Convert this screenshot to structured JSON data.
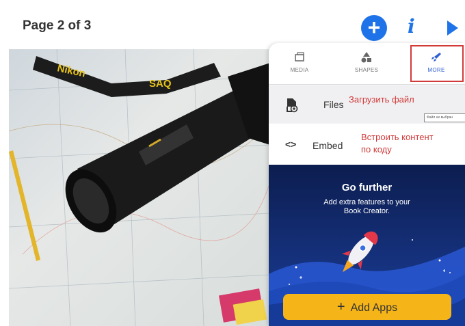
{
  "header": {
    "page_indicator": "Page 2 of 3",
    "add_icon": "plus-icon",
    "info_icon": "info-icon",
    "play_icon": "play-icon"
  },
  "panel": {
    "tabs": [
      {
        "label": "MEDIA",
        "icon": "media-icon"
      },
      {
        "label": "SHAPES",
        "icon": "shapes-icon"
      },
      {
        "label": "MORE",
        "icon": "rocket-icon"
      }
    ],
    "items": [
      {
        "label": "Files",
        "icon": "file-add-icon",
        "annotation": "Загрузить файл"
      },
      {
        "label": "Embed",
        "icon": "code-icon",
        "annotation_line1": "Встроить контент",
        "annotation_line2": "по коду"
      }
    ],
    "tooltip": "Файл не выбран",
    "promo": {
      "title": "Go further",
      "text": "Add extra features to your Book Creator.",
      "button_label": "Add Apps"
    }
  },
  "colors": {
    "accent": "#1e73e8",
    "annotation": "#d23a3a",
    "button": "#f5b518",
    "promo_bg": "#15307a"
  }
}
